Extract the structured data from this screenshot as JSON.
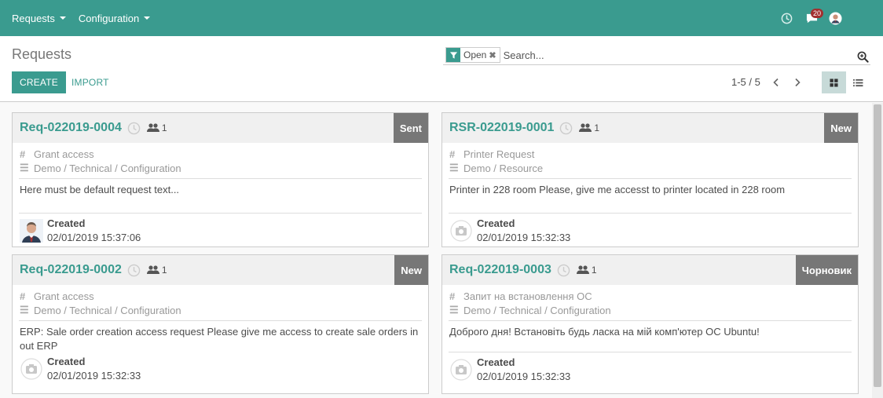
{
  "navbar": {
    "menus": [
      {
        "label": "Requests"
      },
      {
        "label": "Configuration"
      }
    ],
    "messages_count": "20",
    "accent": "#3a9b8f"
  },
  "control_panel": {
    "breadcrumb": "Requests",
    "search": {
      "facet_icon": "filter-icon",
      "facet_value": "Open",
      "placeholder": "Search..."
    },
    "create_label": "CREATE",
    "import_label": "IMPORT",
    "pager_value": "1-5 / 5"
  },
  "cards": [
    {
      "title": "Req-022019-0004",
      "followers": "1",
      "stage": "Sent",
      "type": "Grant access",
      "category": "Demo / Technical / Configuration",
      "text": "Here must be default request text...",
      "footer_label": "Created",
      "footer_date": "02/01/2019 15:37:06",
      "avatar": "user-photo"
    },
    {
      "title": "RSR-022019-0001",
      "followers": "1",
      "stage": "New",
      "type": "Printer Request",
      "category": "Demo / Resource",
      "text": "Printer in 228 room Please, give me accesst to printer located in 228 room",
      "footer_label": "Created",
      "footer_date": "02/01/2019 15:32:33",
      "avatar": "placeholder"
    },
    {
      "title": "Req-022019-0002",
      "followers": "1",
      "stage": "New",
      "type": "Grant access",
      "category": "Demo / Technical / Configuration",
      "text": "ERP: Sale order creation access request Please give me access to create sale orders in out ERP",
      "footer_label": "Created",
      "footer_date": "02/01/2019 15:32:33",
      "avatar": "placeholder"
    },
    {
      "title": "Req-022019-0003",
      "followers": "1",
      "stage": "Чорновик",
      "type": "Запит на встановлення ОС",
      "category": "Demo / Technical / Configuration",
      "text": "Доброго дня! Встановіть будь ласка на мій комп'ютер ОС Ubuntu!",
      "footer_label": "Created",
      "footer_date": "02/01/2019 15:32:33",
      "avatar": "placeholder"
    }
  ]
}
